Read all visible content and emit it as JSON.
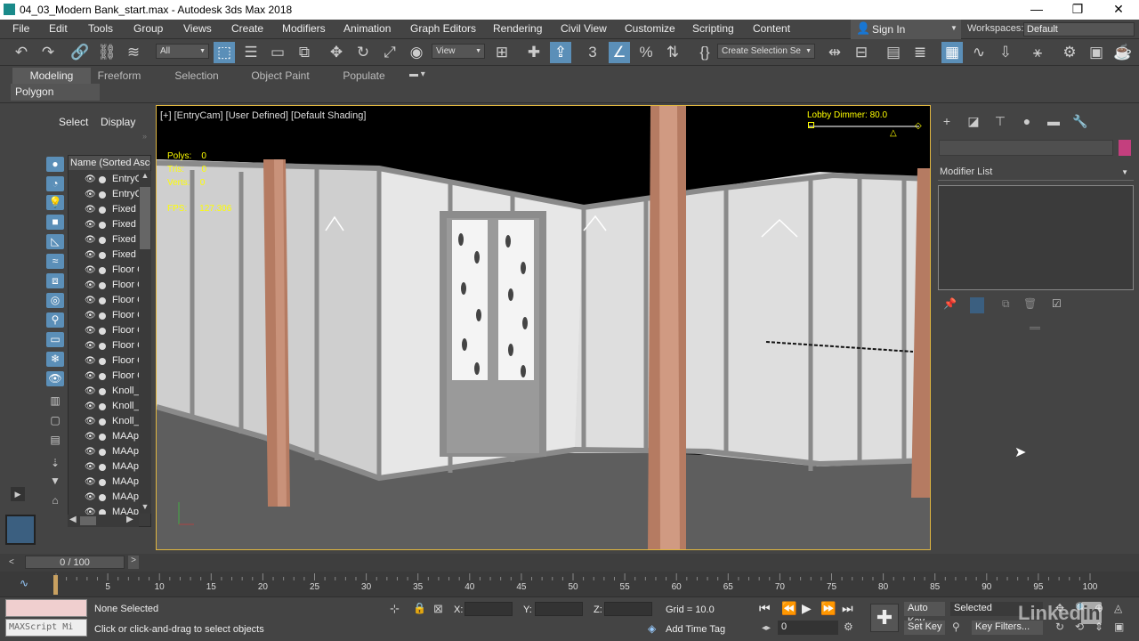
{
  "window": {
    "title": "04_03_Modern Bank_start.max - Autodesk 3ds Max 2018",
    "minimize": "—",
    "maximize": "❐",
    "close": "✕"
  },
  "menubar": {
    "items": [
      "File",
      "Edit",
      "Tools",
      "Group",
      "Views",
      "Create",
      "Modifiers",
      "Animation",
      "Graph Editors",
      "Rendering",
      "Civil View",
      "Customize",
      "Scripting",
      "Content"
    ],
    "sign_in": "Sign In",
    "workspaces_label": "Workspaces:",
    "workspace_value": "Default"
  },
  "toolbar": {
    "selection_filter": "All",
    "reference_coord": "View",
    "named_selection_placeholder": "Create Selection Se"
  },
  "ribbon": {
    "tabs": [
      "Modeling",
      "Freeform",
      "Selection",
      "Object Paint",
      "Populate"
    ],
    "panel_label": "Polygon Modeling"
  },
  "explorer": {
    "tab_select": "Select",
    "tab_display": "Display",
    "column_header": "Name (Sorted Ascen",
    "rows": [
      "EntryC",
      "EntryC",
      "Fixed",
      "Fixed",
      "Fixed",
      "Fixed",
      "Floor C",
      "Floor C",
      "Floor C",
      "Floor C",
      "Floor C",
      "Floor C",
      "Floor C",
      "Floor C",
      "Knoll_",
      "Knoll_",
      "Knoll_",
      "MAAp",
      "MAAp",
      "MAAp",
      "MAAp",
      "MAAp",
      "MAAp"
    ]
  },
  "viewport": {
    "label": "[+] [EntryCam] [User Defined] [Default Shading]",
    "stats": {
      "polys_label": "Polys:",
      "polys": "0",
      "tris_label": "Tris:",
      "tris": "0",
      "verts_label": "Verts:",
      "verts": "0"
    },
    "fps_label": "FPS:",
    "fps": "127.306",
    "dimmer_label": "Lobby Dimmer: 80.0"
  },
  "command_panel": {
    "modifier_list": "Modifier List",
    "name_color": "#c43f7e"
  },
  "timeline": {
    "frame_display": "0 / 100",
    "ticks": [
      "0",
      "5",
      "10",
      "15",
      "20",
      "25",
      "30",
      "35",
      "40",
      "45",
      "50",
      "55",
      "60",
      "65",
      "70",
      "75",
      "80",
      "85",
      "90",
      "95",
      "100"
    ]
  },
  "status": {
    "maxscript_placeholder": "MAXScript Mi",
    "selection": "None Selected",
    "prompt": "Click or click-and-drag to select objects",
    "x_label": "X:",
    "y_label": "Y:",
    "z_label": "Z:",
    "grid": "Grid = 10.0",
    "add_time_tag": "Add Time Tag",
    "auto_key": "Auto Key",
    "selected": "Selected",
    "set_key": "Set Key",
    "key_filters": "Key Filters...",
    "frame": "0"
  }
}
